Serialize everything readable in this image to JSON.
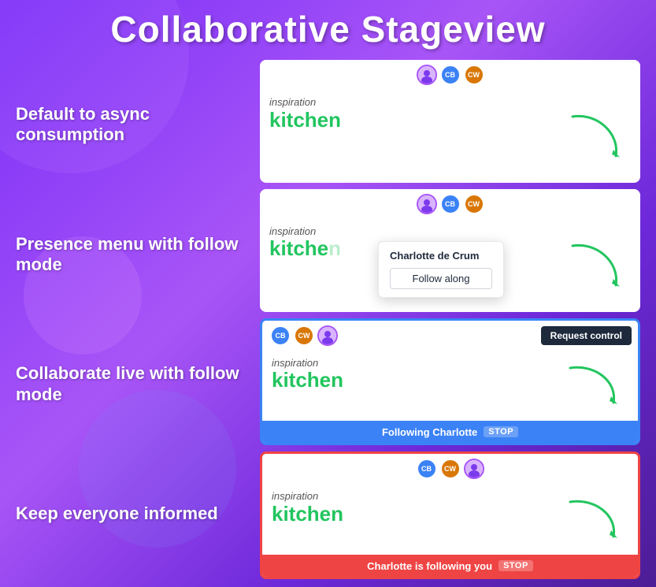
{
  "page": {
    "title": "Collaborative Stageview",
    "bg_color": "#7b2ff7"
  },
  "sections": [
    {
      "id": "section1",
      "label": "Default to async consumption"
    },
    {
      "id": "section2",
      "label": "Presence menu with follow mode"
    },
    {
      "id": "section3",
      "label": "Collaborate live with follow mode"
    },
    {
      "id": "section4",
      "label": "Keep everyone informed"
    }
  ],
  "panels": [
    {
      "id": "panel1",
      "inspiration_label": "inspiration",
      "kitchen_text": "kitchen"
    },
    {
      "id": "panel2",
      "inspiration_label": "inspiration",
      "kitchen_text": "kitche",
      "popup": {
        "name": "Charlotte de Crum",
        "follow_button": "Follow along"
      }
    },
    {
      "id": "panel3",
      "inspiration_label": "inspiration",
      "kitchen_text": "kitchen",
      "request_control_label": "Request control",
      "following_bar": "Following Charlotte",
      "stop_label": "STOP"
    },
    {
      "id": "panel4",
      "inspiration_label": "inspiration",
      "kitchen_text": "kitchen",
      "charlotte_bar": "Charlotte is following you",
      "stop_label": "STOP"
    }
  ],
  "avatars": {
    "cb_initials": "CB",
    "cw_initials": "CW"
  }
}
